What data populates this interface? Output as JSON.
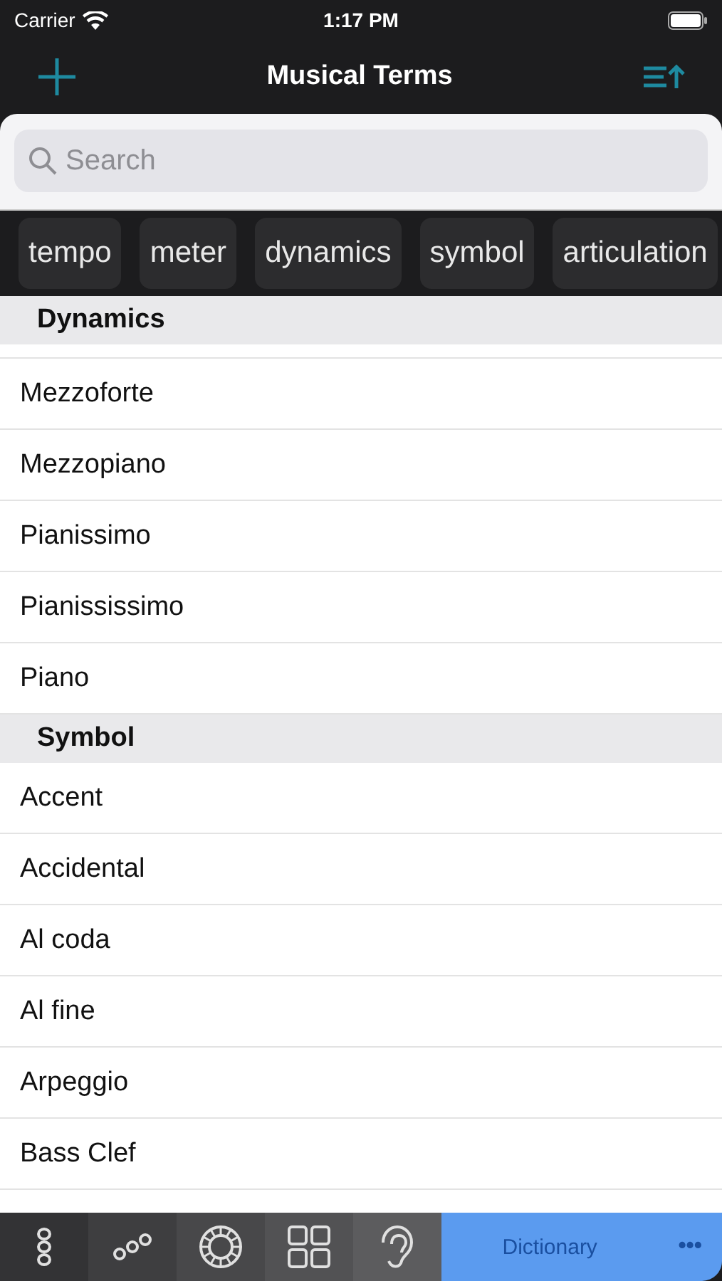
{
  "status_bar": {
    "carrier": "Carrier",
    "time": "1:17 PM"
  },
  "nav": {
    "title": "Musical Terms"
  },
  "search": {
    "placeholder": "Search"
  },
  "filters": [
    {
      "label": "tempo"
    },
    {
      "label": "meter"
    },
    {
      "label": "dynamics"
    },
    {
      "label": "symbol"
    },
    {
      "label": "articulation"
    }
  ],
  "sections": [
    {
      "title": "Dynamics",
      "rows": [
        "Mezzoforte",
        "Mezzopiano",
        "Pianissimo",
        "Pianississimo",
        "Piano"
      ]
    },
    {
      "title": "Symbol",
      "rows": [
        "Accent",
        "Accidental",
        "Al coda",
        "Al fine",
        "Arpeggio",
        "Bass Clef"
      ]
    }
  ],
  "tab_bar": {
    "tabs": [
      {
        "kind": "vertical-rings",
        "selected": false
      },
      {
        "kind": "diagonal-rings",
        "selected": false
      },
      {
        "kind": "wheel",
        "selected": false
      },
      {
        "kind": "grid",
        "selected": false
      },
      {
        "kind": "ear",
        "selected": false
      },
      {
        "kind": "text",
        "label": "Dictionary",
        "selected": true
      }
    ],
    "more": "•••"
  }
}
